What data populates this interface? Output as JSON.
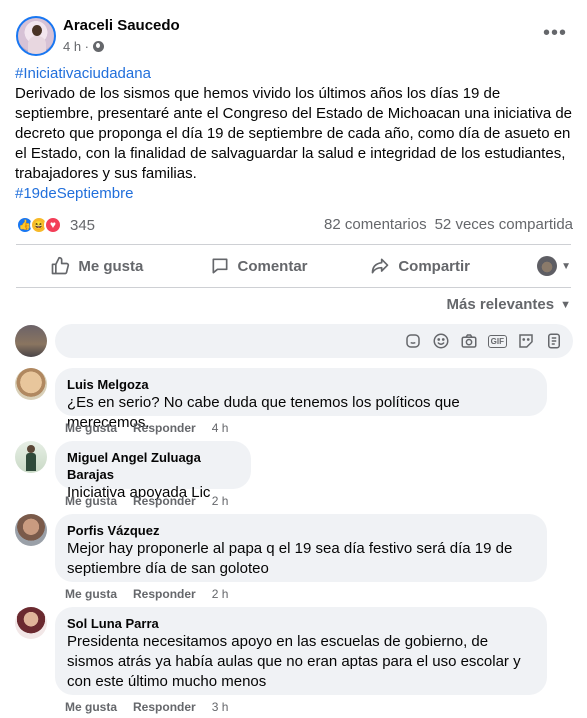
{
  "post": {
    "author": "Araceli Saucedo",
    "time": "4 h ·",
    "hashtag_top": "#Iniciativaciudadana",
    "body": "Derivado de los sismos que hemos vivido los últimos años los días 19 de septiembre, presentaré ante el Congreso del Estado de Michoacan una iniciativa de decreto que proponga el día 19 de septiembre de cada año, como día de asueto en el Estado, con la finalidad de salvaguardar la salud e integridad de los estudiantes, trabajadores y sus familias.",
    "hashtag_bottom": "#19deSeptiembre",
    "more_icon": "more-horizontal-icon",
    "privacy_icon": "globe-icon"
  },
  "reactions": {
    "count": "345",
    "types": [
      "like-icon",
      "haha-icon",
      "love-icon"
    ],
    "comments": "82 comentarios",
    "shares": "52 veces compartida"
  },
  "actions": {
    "like": "Me gusta",
    "comment": "Comentar",
    "share": "Compartir"
  },
  "sort": {
    "label": "Más relevantes"
  },
  "composer": {
    "tools": [
      "sticker-icon",
      "emoji-icon",
      "camera-icon",
      "gif-icon",
      "sticker-face-icon",
      "avatar-sticker-icon"
    ],
    "gif_label": "GIF"
  },
  "comments": [
    {
      "name": "Luis Melgoza",
      "text": "¿Es en serio? No cabe duda que tenemos los políticos que merecemos.",
      "like": "Me gusta",
      "reply": "Responder",
      "time": "4 h"
    },
    {
      "name": "Miguel Angel Zuluaga Barajas",
      "text": "Iniciativa apoyada Lic",
      "like": "Me gusta",
      "reply": "Responder",
      "time": "2 h"
    },
    {
      "name": "Porfis Vázquez",
      "text": "Mejor hay proponerle al papa q el 19 sea día festivo será día 19 de septiembre día de san goloteo",
      "like": "Me gusta",
      "reply": "Responder",
      "time": "2 h"
    },
    {
      "name": "Sol Luna Parra",
      "text": "Presidenta necesitamos apoyo en las escuelas de gobierno, de sismos atrás ya había aulas que no eran aptas para el uso escolar y con este último mucho menos",
      "like": "Me gusta",
      "reply": "Responder",
      "time": "3 h"
    }
  ],
  "colors": {
    "accent": "#1877f2",
    "hashtag": "#216fdb",
    "muted": "#65676b",
    "bubble": "#f0f2f5"
  }
}
